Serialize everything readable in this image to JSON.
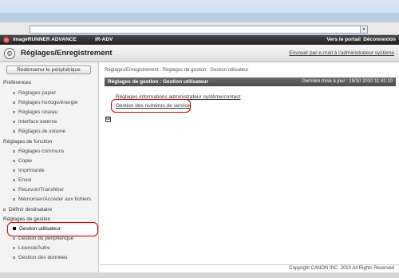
{
  "app": {
    "product": "imageRUNNER ADVANCE",
    "model": "iR-ADV",
    "portal_link": "Vers le portail",
    "logout_link": "Déconnexion",
    "page_title": "Réglages/Enregistrement",
    "email_admin_link": "Envoyer par e-mail à l'administrateur système",
    "addr_dropdown": "▾"
  },
  "sidebar": {
    "restart_button": "Redémarrer le périphérique",
    "items": [
      {
        "label": "Préférences",
        "kind": "cat"
      },
      {
        "label": "Réglages papier",
        "kind": "sub"
      },
      {
        "label": "Réglages horloge/énergie",
        "kind": "sub"
      },
      {
        "label": "Réglages réseau",
        "kind": "sub"
      },
      {
        "label": "Interface externe",
        "kind": "sub"
      },
      {
        "label": "Réglages de volume",
        "kind": "sub"
      },
      {
        "label": "Réglages de fonction",
        "kind": "cat"
      },
      {
        "label": "Réglages communs",
        "kind": "sub"
      },
      {
        "label": "Copie",
        "kind": "sub"
      },
      {
        "label": "Imprimante",
        "kind": "sub"
      },
      {
        "label": "Envoi",
        "kind": "sub"
      },
      {
        "label": "Recevoir/Transférer",
        "kind": "sub"
      },
      {
        "label": "Mémoriser/Accéder aux fichiers",
        "kind": "sub"
      },
      {
        "label": "Définir destinataire",
        "kind": "cat"
      },
      {
        "label": "Réglages de gestion",
        "kind": "cat"
      },
      {
        "label": "Gestion utilisateur",
        "kind": "sub",
        "selected": true
      },
      {
        "label": "Gestion du périphérique",
        "kind": "sub"
      },
      {
        "label": "Licence/Autre",
        "kind": "sub"
      },
      {
        "label": "Gestion des données",
        "kind": "sub"
      }
    ]
  },
  "main": {
    "breadcrumb": "Réglages/Enregistrement : Réglages de gestion : Gestion utilisateur",
    "panel_title": "Réglages de gestion : Gestion utilisateur",
    "last_update": "Dernière mise à jour : 18/10 2010 11:41:10",
    "links": [
      "Réglages informations administrateur système/contact",
      "Gestion des numéros de service"
    ],
    "expand_icon": "⊞"
  },
  "footer": {
    "copyright": "Copyright CANON INC. 2010 All Rights Reserved"
  },
  "colors": {
    "highlight_ring": "#c80000",
    "appbar": "#2a2a2a",
    "panelbar": "#575757"
  }
}
